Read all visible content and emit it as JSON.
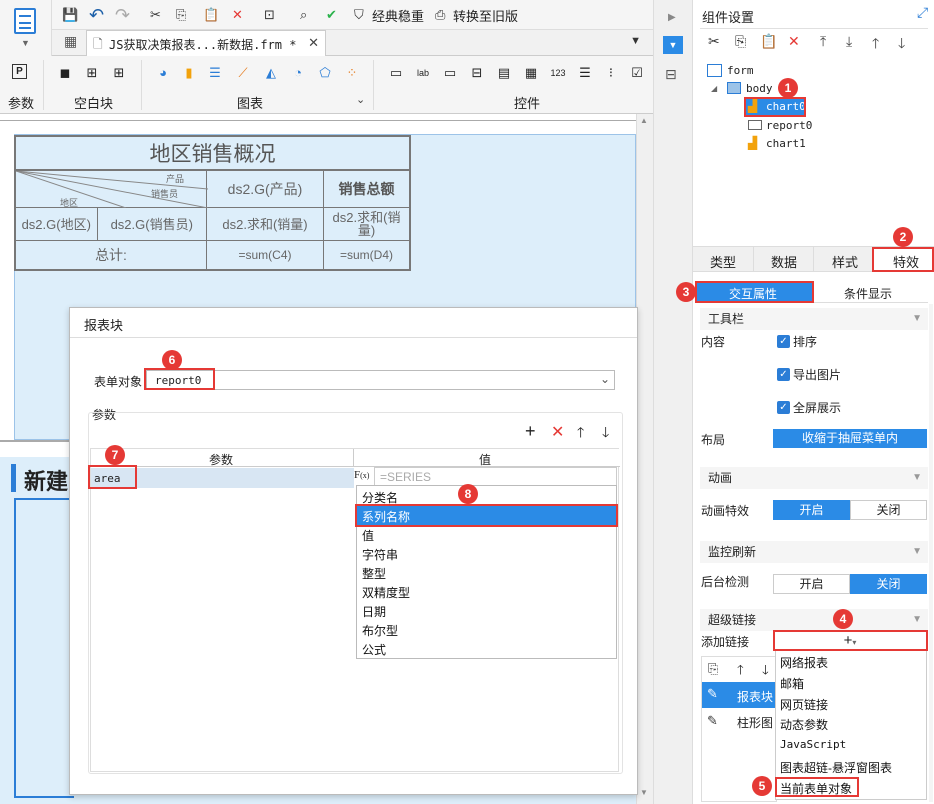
{
  "toolbar": {
    "classic_label": "经典稳重",
    "old_version_label": "转换至旧版"
  },
  "tab": {
    "title": "JS获取决策报表...新数据.frm *"
  },
  "ribbon": {
    "param_label": "参数",
    "blank_label": "空白块",
    "chart_label": "图表",
    "widget_label": "控件"
  },
  "report": {
    "title": "地区销售概况",
    "diag_product": "产品",
    "diag_salesman": "销售员",
    "diag_region": "地区",
    "h_product": "ds2.G(产品)",
    "h_total": "销售总额",
    "c_region": "ds2.G(地区)",
    "c_salesman": "ds2.G(销售员)",
    "c_sum_qty": "ds2.求和(销量)",
    "c_sum_qty2": "ds2.求和(销量)",
    "footer_label": "总计:",
    "footer_c4": "=sum(C4)",
    "footer_d4": "=sum(D4)"
  },
  "new_block_label": "新建",
  "dialog": {
    "title": "报表块",
    "form_object_label": "表单对象",
    "form_object_value": "report0",
    "params_label": "参数",
    "col_param": "参数",
    "col_value": "值",
    "row_param": "area",
    "formula_placeholder": "=SERIES",
    "options": [
      "分类名",
      "系列名称",
      "值",
      "字符串",
      "整型",
      "双精度型",
      "日期",
      "布尔型",
      "公式"
    ]
  },
  "panel": {
    "title": "组件设置",
    "tree": [
      "form",
      "body",
      "chart0",
      "report0",
      "chart1"
    ],
    "tabs": [
      "类型",
      "数据",
      "样式",
      "特效"
    ],
    "sub_tabs": [
      "交互属性",
      "条件显示"
    ],
    "toolbar_section": "工具栏",
    "content_label": "内容",
    "sort_label": "排序",
    "export_label": "导出图片",
    "fullscreen_label": "全屏展示",
    "layout_label": "布局",
    "layout_value": "收缩于抽屉菜单内",
    "anim_section": "动画",
    "anim_effect_label": "动画特效",
    "on_label": "开启",
    "off_label": "关闭",
    "monitor_section": "监控刷新",
    "bg_check_label": "后台检测",
    "link_section": "超级链接",
    "add_link_label": "添加链接",
    "link_row1": "报表块",
    "link_row2": "柱形图",
    "link_menu": [
      "网络报表",
      "邮箱",
      "网页链接",
      "动态参数",
      "JavaScript",
      "图表超链-悬浮窗图表",
      "当前表单对象"
    ]
  },
  "badges": [
    "1",
    "2",
    "3",
    "4",
    "5",
    "6",
    "7",
    "8"
  ],
  "colors": {
    "accent": "#2b8be6",
    "highlight": "#e53935",
    "canvas_bg": "#ddeefa"
  }
}
